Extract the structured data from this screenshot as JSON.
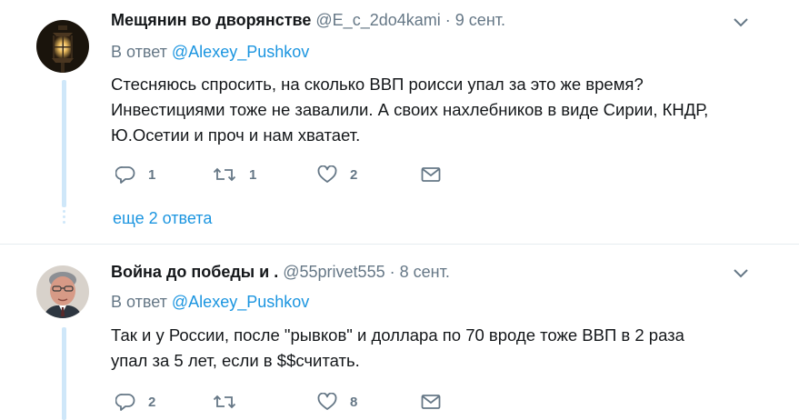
{
  "tweets": [
    {
      "author_name": "Мещянин во дворянстве",
      "handle": "@E_c_2do4kami",
      "separator": "·",
      "date": "9 сент.",
      "reply_prefix": "В ответ",
      "reply_handle": "@Alexey_Pushkov",
      "text_lines": [
        "Стесняюсь спросить, на сколько ВВП роисси упал за это же время?",
        "Инвестициями тоже не завалили. А своих нахлебников в виде Сирии, КНДР,",
        "Ю.Осетии и проч и нам хватает."
      ],
      "reply_count": "1",
      "retweet_count": "1",
      "like_count": "2",
      "more_replies": "еще 2 ответа",
      "avatar_icon": "lantern-avatar"
    },
    {
      "author_name": "Война до победы и .",
      "handle": "@55privet555",
      "separator": "·",
      "date": "8 сент.",
      "reply_prefix": "В ответ",
      "reply_handle": "@Alexey_Pushkov",
      "text_lines": [
        "Так и у России, после \"рывков\" и доллара по 70 вроде тоже ВВП в 2 раза",
        "упал за 5 лет, если в $$считать."
      ],
      "reply_count": "2",
      "retweet_count": "",
      "like_count": "8",
      "avatar_icon": "man-portrait-avatar"
    }
  ],
  "colors": {
    "link": "#1b95e0",
    "muted": "#657786",
    "thread_line": "#cfe7f9",
    "divider": "#e6ecf0"
  },
  "icons": [
    "reply-icon",
    "retweet-icon",
    "like-icon",
    "dm-icon",
    "chevron-down-icon"
  ]
}
